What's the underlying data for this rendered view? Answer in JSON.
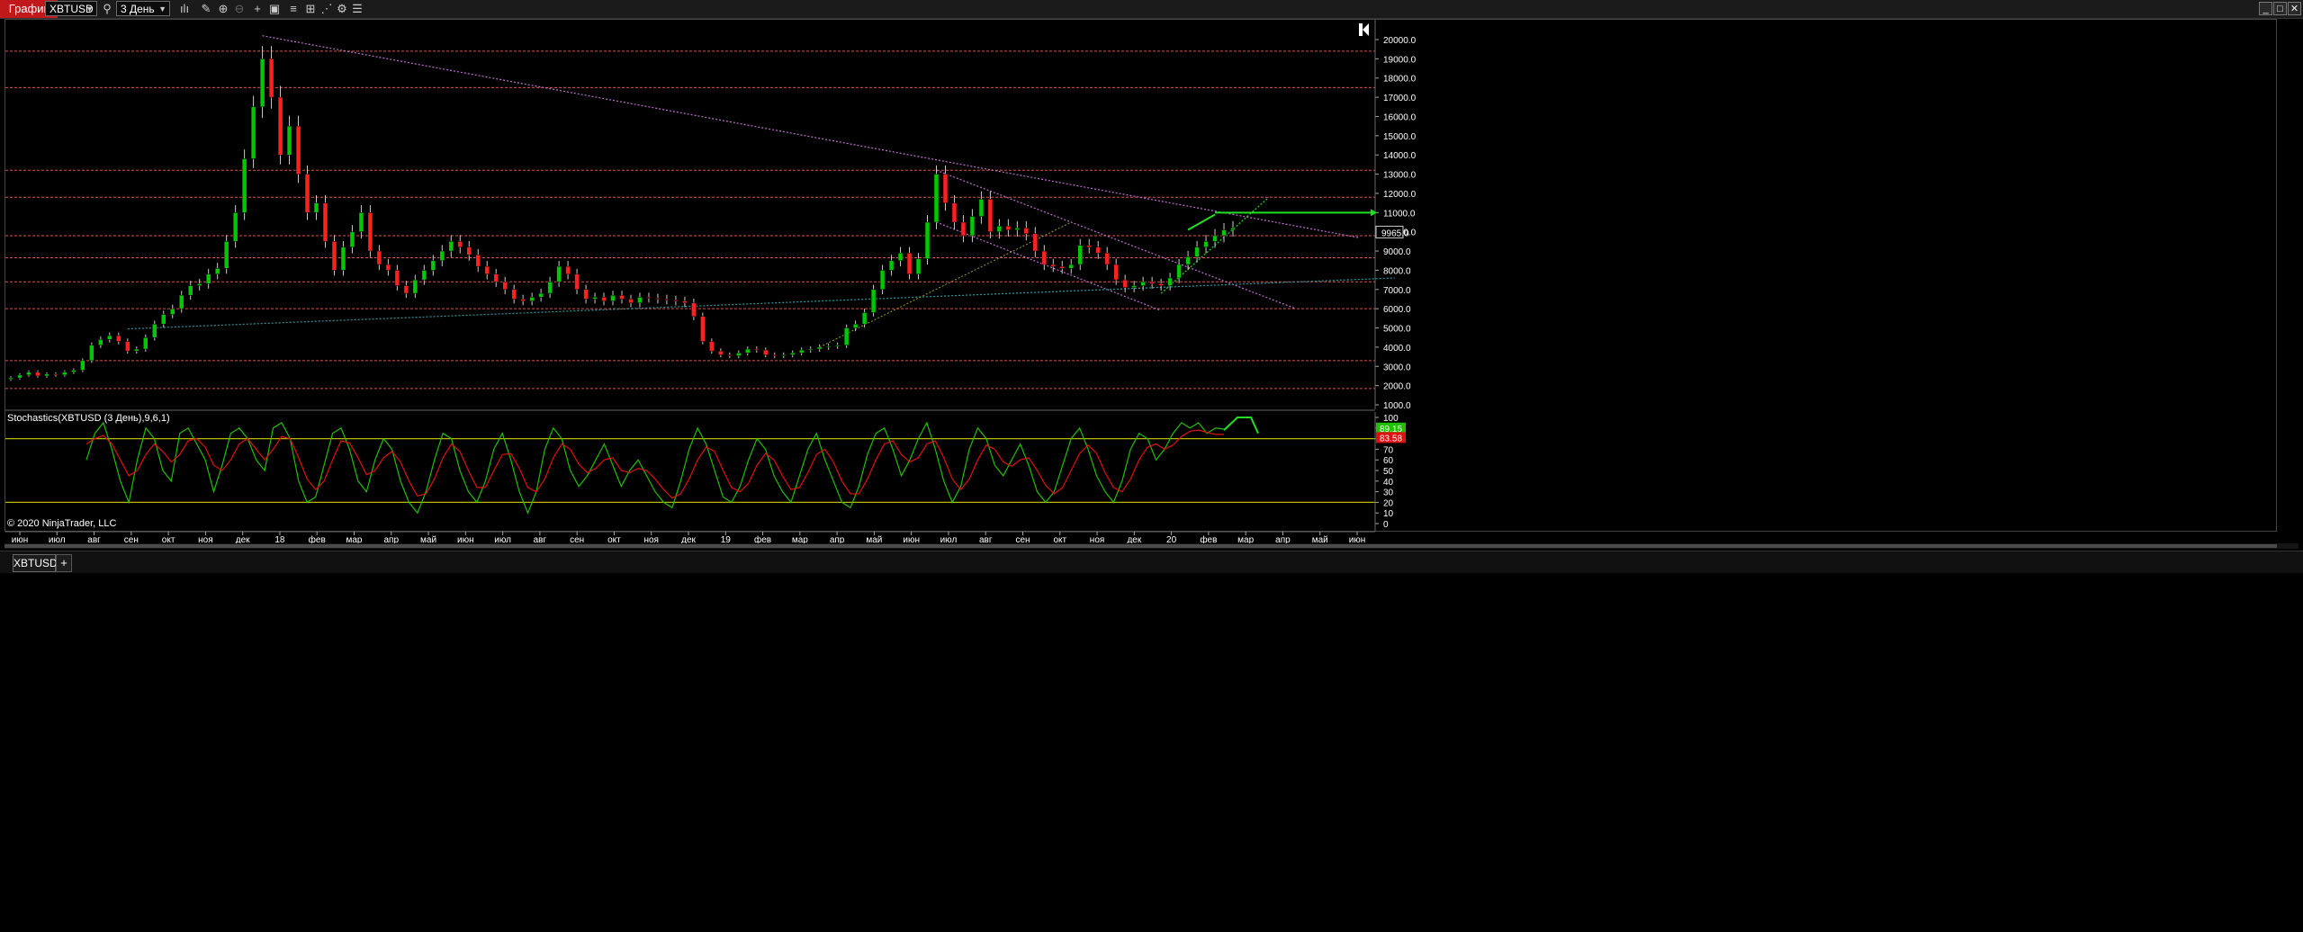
{
  "toolbar": {
    "title": "График",
    "instrument": "XBTUSD",
    "period": "3 День",
    "icons": [
      "search-icon",
      "bar-type-icon",
      "pencil-icon",
      "zoom-in-icon",
      "zoom-out-icon",
      "crosshair-icon",
      "data-box-icon",
      "indicators-icon",
      "strategies-icon",
      "drawing-tools-icon",
      "properties-icon",
      "menu-icon"
    ]
  },
  "indicator_label": "Stochastics(XBTUSD (3 День),9,6,1)",
  "copyright": "© 2020 NinjaTrader, LLC",
  "price_flag": "9965.0",
  "stoch_flags": [
    "89.15",
    "83.58"
  ],
  "tab": "XBTUSD",
  "tab_add": "+",
  "colors": {
    "bull": "#00c800",
    "bear": "#ff2020",
    "hline": "#e0504a",
    "stoch_k": "#20c000",
    "stoch_d": "#e01010",
    "stoch_level": "#b8b800",
    "trend_pink": "#c070d0",
    "trend_teal": "#2b9aa0",
    "trend_olive": "#9a9a30",
    "trend_green": "#20e020"
  },
  "chart_data": [
    {
      "type": "candlestick",
      "instrument": "XBTUSD",
      "period": "3 День",
      "y_ticks": [
        1000,
        2000,
        3000,
        4000,
        5000,
        6000,
        7000,
        8000,
        9000,
        10000,
        11000,
        12000,
        13000,
        14000,
        15000,
        16000,
        17000,
        18000,
        19000,
        20000
      ],
      "ylim": [
        500,
        21000
      ],
      "x_ticks": [
        "июн",
        "июл",
        "авг",
        "сен",
        "окт",
        "ноя",
        "дек",
        "18",
        "фев",
        "мар",
        "апр",
        "май",
        "июн",
        "июл",
        "авг",
        "сен",
        "окт",
        "ноя",
        "дек",
        "19",
        "фев",
        "мар",
        "апр",
        "май",
        "июн",
        "июл",
        "авг",
        "сен",
        "окт",
        "ноя",
        "дек",
        "20",
        "фев",
        "мар",
        "апр",
        "май",
        "июн"
      ],
      "horizontal_levels": [
        1850,
        3300,
        6000,
        7400,
        8650,
        9800,
        11800,
        13200,
        17500,
        19400
      ],
      "last_price": 9965.0,
      "closes": [
        2400,
        2550,
        2700,
        2500,
        2600,
        2550,
        2700,
        2800,
        3300,
        4100,
        4400,
        4600,
        4300,
        3800,
        3900,
        4500,
        5200,
        5700,
        6000,
        6700,
        7200,
        7300,
        7800,
        8100,
        9500,
        11000,
        13800,
        16500,
        19000,
        17000,
        14000,
        15500,
        13000,
        11000,
        11500,
        9500,
        8000,
        9200,
        10000,
        11000,
        9000,
        8300,
        8000,
        7200,
        6800,
        7500,
        8000,
        8500,
        9000,
        9500,
        9200,
        8800,
        8200,
        7800,
        7400,
        7000,
        6500,
        6400,
        6600,
        6800,
        7400,
        8200,
        7800,
        7000,
        6500,
        6600,
        6400,
        6700,
        6500,
        6300,
        6600,
        6550,
        6500,
        6450,
        6400,
        6300,
        5600,
        4300,
        3800,
        3600,
        3550,
        3700,
        3900,
        3850,
        3600,
        3550,
        3600,
        3700,
        3850,
        3900,
        4000,
        4050,
        4100,
        5000,
        5200,
        5800,
        7000,
        8000,
        8500,
        8900,
        7800,
        8600,
        10500,
        13000,
        11500,
        10500,
        9800,
        10800,
        11700,
        10000,
        10300,
        10100,
        10200,
        9900,
        9000,
        8300,
        8200,
        8100,
        8300,
        9300,
        9200,
        8900,
        8300,
        7500,
        7100,
        7200,
        7400,
        7300,
        7200,
        7600,
        8300,
        8700,
        9200,
        9500,
        9800,
        10100,
        10200
      ],
      "annotation_target": 11000
    },
    {
      "type": "line",
      "title": "Stochastics(XBTUSD (3 День),9,6,1)",
      "y_ticks": [
        0,
        10,
        20,
        30,
        40,
        50,
        60,
        70,
        80,
        90,
        100
      ],
      "ylim": [
        -5,
        105
      ],
      "levels": [
        20,
        80
      ],
      "series": [
        {
          "name": "K",
          "values": [
            60,
            85,
            95,
            70,
            40,
            20,
            60,
            90,
            80,
            50,
            40,
            85,
            90,
            75,
            60,
            30,
            55,
            85,
            90,
            80,
            60,
            50,
            90,
            95,
            80,
            40,
            20,
            25,
            55,
            85,
            90,
            70,
            40,
            30,
            60,
            80,
            70,
            40,
            20,
            10,
            30,
            60,
            85,
            80,
            50,
            30,
            20,
            40,
            70,
            85,
            60,
            30,
            10,
            30,
            70,
            90,
            80,
            50,
            35,
            45,
            60,
            75,
            55,
            35,
            50,
            60,
            45,
            30,
            20,
            15,
            40,
            70,
            90,
            75,
            50,
            25,
            20,
            35,
            60,
            80,
            70,
            45,
            30,
            20,
            45,
            70,
            85,
            60,
            40,
            20,
            15,
            35,
            65,
            85,
            90,
            70,
            45,
            60,
            80,
            95,
            70,
            40,
            20,
            35,
            70,
            90,
            80,
            55,
            45,
            60,
            75,
            55,
            30,
            20,
            30,
            55,
            80,
            90,
            70,
            45,
            30,
            20,
            40,
            70,
            85,
            80,
            60,
            70,
            85,
            95,
            90,
            95,
            85,
            90,
            89
          ]
        },
        {
          "name": "D",
          "values": [
            75,
            80,
            83,
            75,
            60,
            45,
            50,
            65,
            75,
            68,
            58,
            65,
            78,
            80,
            72,
            55,
            50,
            60,
            75,
            80,
            70,
            60,
            70,
            82,
            80,
            62,
            42,
            32,
            40,
            60,
            78,
            76,
            62,
            46,
            50,
            62,
            68,
            58,
            40,
            26,
            28,
            42,
            62,
            75,
            68,
            50,
            34,
            34,
            50,
            65,
            66,
            52,
            34,
            30,
            42,
            62,
            75,
            70,
            56,
            48,
            52,
            60,
            62,
            50,
            48,
            52,
            50,
            42,
            32,
            24,
            28,
            42,
            60,
            72,
            68,
            50,
            34,
            30,
            38,
            55,
            66,
            60,
            45,
            32,
            34,
            48,
            65,
            70,
            58,
            40,
            28,
            28,
            42,
            60,
            75,
            78,
            65,
            58,
            62,
            75,
            78,
            62,
            42,
            32,
            42,
            60,
            74,
            70,
            58,
            54,
            60,
            62,
            50,
            36,
            28,
            34,
            50,
            66,
            74,
            66,
            48,
            34,
            30,
            42,
            60,
            72,
            75,
            70,
            74,
            82,
            87,
            88,
            86,
            84,
            84
          ]
        }
      ]
    }
  ]
}
